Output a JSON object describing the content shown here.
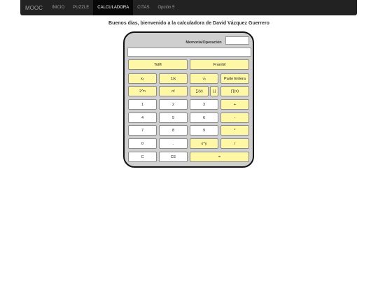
{
  "nav": {
    "brand": "MOOC",
    "items": [
      "INICIO",
      "PUZZLE",
      "CALCULADORA",
      "CITAS",
      "Opción 5"
    ]
  },
  "greeting": "Buenos días, bienvenido a la calculadora de David Vázquez Guerrero",
  "calculator": {
    "memory_label": "Memoria/Operación",
    "memory_value": "",
    "display_value": "",
    "buttons": {
      "tom": "ToM",
      "fromm": "FromM",
      "x2": "x₂",
      "inv": "1/x",
      "sqrt": "√ₓ",
      "intpart": "Parte Entera",
      "pow2": "2^n",
      "fact": "n!",
      "sum": "∑(x)",
      "comma": "|,|",
      "prod": "∏(x)",
      "n1": "1",
      "n2": "2",
      "n3": "3",
      "plus": "+",
      "n4": "4",
      "n5": "5",
      "n6": "6",
      "minus": "-",
      "n7": "7",
      "n8": "8",
      "n9": "9",
      "mul": "*",
      "n0": "0",
      "dot": ".",
      "powxy": "x^y",
      "div": "/",
      "clear": "C",
      "ce": "CE",
      "equals": "="
    },
    "colors": {
      "function_key": "#fdf7a6",
      "digit_key": "#ffffff",
      "body": "#cfcfcf"
    }
  }
}
